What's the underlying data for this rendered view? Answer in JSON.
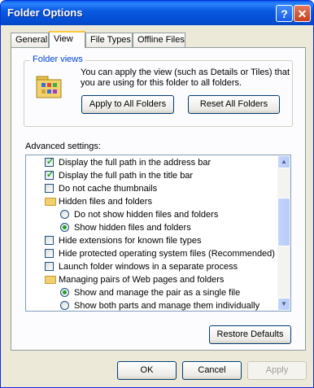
{
  "window": {
    "title": "Folder Options",
    "help_label": "?",
    "close_label": "✕"
  },
  "tabs": [
    {
      "label": "General"
    },
    {
      "label": "View"
    },
    {
      "label": "File Types"
    },
    {
      "label": "Offline Files"
    }
  ],
  "folder_views": {
    "legend": "Folder views",
    "description": "You can apply the view (such as Details or Tiles) that you are using for this folder to all folders.",
    "apply_label": "Apply to All Folders",
    "reset_label": "Reset All Folders"
  },
  "advanced": {
    "label": "Advanced settings:",
    "items": [
      {
        "type": "checkbox",
        "checked": true,
        "label": "Display the full path in the address bar"
      },
      {
        "type": "checkbox",
        "checked": true,
        "label": "Display the full path in the title bar"
      },
      {
        "type": "checkbox",
        "checked": false,
        "label": "Do not cache thumbnails"
      },
      {
        "type": "folder",
        "label": "Hidden files and folders"
      },
      {
        "type": "radio",
        "checked": false,
        "label": "Do not show hidden files and folders"
      },
      {
        "type": "radio",
        "checked": true,
        "label": "Show hidden files and folders"
      },
      {
        "type": "checkbox",
        "checked": false,
        "label": "Hide extensions for known file types"
      },
      {
        "type": "checkbox",
        "checked": false,
        "label": "Hide protected operating system files (Recommended)"
      },
      {
        "type": "checkbox",
        "checked": false,
        "label": "Launch folder windows in a separate process"
      },
      {
        "type": "folder",
        "label": "Managing pairs of Web pages and folders"
      },
      {
        "type": "radio",
        "checked": true,
        "label": "Show and manage the pair as a single file"
      },
      {
        "type": "radio",
        "checked": false,
        "label": "Show both parts and manage them individually"
      }
    ],
    "restore_label": "Restore Defaults"
  },
  "footer": {
    "ok_label": "OK",
    "cancel_label": "Cancel",
    "apply_label": "Apply"
  },
  "colors": {
    "title_bar": "#0a5ee8",
    "accent": "#0046d5",
    "check": "#21a121"
  }
}
